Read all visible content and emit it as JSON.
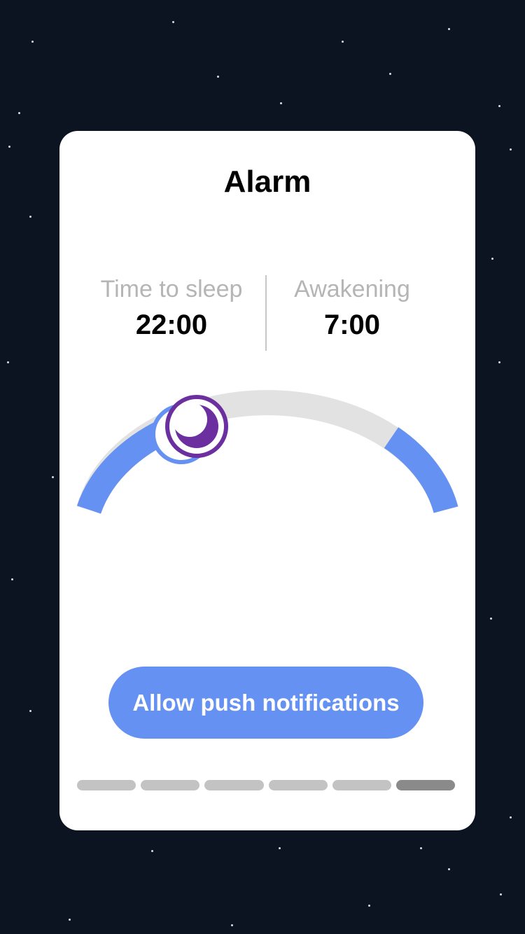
{
  "title": "Alarm",
  "sleep": {
    "label": "Time to sleep",
    "value": "22:00"
  },
  "wake": {
    "label": "Awakening",
    "value": "7:00"
  },
  "dial": {
    "handles": [
      "moon-icon",
      "sun-icon"
    ],
    "colors": {
      "active": "#6591f2",
      "track": "#e2e2e2",
      "moon": "#6b2fa0"
    }
  },
  "cta": {
    "label": "Allow push notifications",
    "color": "#6591f2"
  },
  "pager": {
    "count": 6,
    "active_index": 5
  }
}
